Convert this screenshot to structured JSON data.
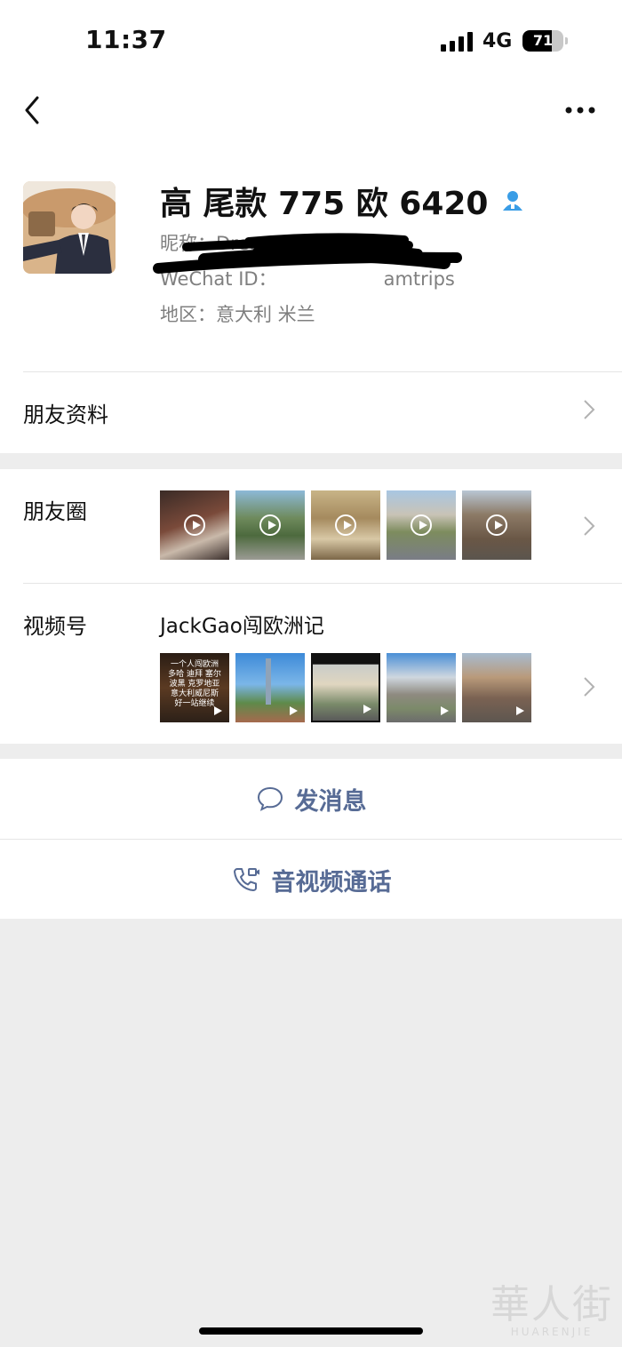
{
  "status_bar": {
    "time": "11:37",
    "network": "4G",
    "battery": "71",
    "battery_level": 0.71
  },
  "header": {
    "back_icon": "chevron-left-icon",
    "more_icon": "more-dots-icon"
  },
  "profile": {
    "name": "高 尾款 775 欧 6420",
    "badge_icon": "contact-person-icon",
    "nickname": "昵称：Dream_Jour",
    "wechat_id": "WeChat ID：",
    "wechat_id_suffix": "amtrips",
    "region": "地区：意大利 米兰"
  },
  "rows": {
    "friend_info": "朋友资料",
    "moments": "朋友圈",
    "channels": "视频号",
    "channel_name": "JackGao闯欧洲记"
  },
  "channel_thumb_text": [
    "一个人闯欧洲",
    "多哈 迪拜 塞尔",
    "波黑 克罗地亚",
    "意大利威尼斯",
    "好一站继续"
  ],
  "actions": {
    "message": "发消息",
    "call": "音视频通话"
  },
  "watermark": {
    "cn": "華人街",
    "en": "HUARENJIE"
  },
  "colors": {
    "link": "#576b95",
    "badge": "#3a9de6",
    "background": "#ededed"
  }
}
